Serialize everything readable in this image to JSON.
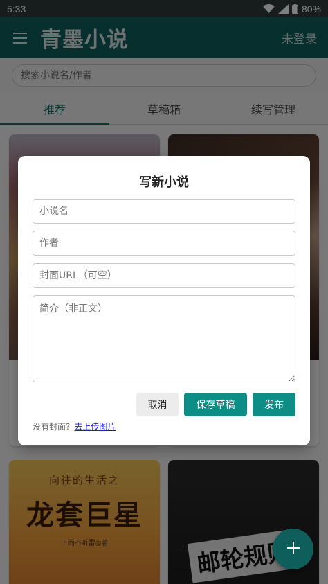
{
  "status_bar": {
    "time": "5:33",
    "battery": "80%"
  },
  "app_bar": {
    "title": "青墨小说",
    "login": "未登录"
  },
  "search": {
    "placeholder": "搜索小说名/作者"
  },
  "tabs": [
    {
      "label": "推荐",
      "active": true
    },
    {
      "label": "草稿箱",
      "active": false
    },
    {
      "label": "续写管理",
      "active": false
    }
  ],
  "covers": {
    "card3": {
      "subtitle": "向往的生活之",
      "title": "龙套巨星",
      "author": "下雨不听雷◎著"
    },
    "card4": {
      "title": "邮轮规则"
    }
  },
  "dialog": {
    "title": "写新小说",
    "fields": {
      "name_placeholder": "小说名",
      "author_placeholder": "作者",
      "cover_placeholder": "封面URL（可空）",
      "intro_placeholder": "简介（非正文）"
    },
    "buttons": {
      "cancel": "取消",
      "save": "保存草稿",
      "publish": "发布"
    },
    "hint_text": "没有封面?",
    "upload_link": "去上传图片"
  },
  "colors": {
    "primary": "#0e5f5c",
    "accent": "#0e8c86",
    "link": "#1a1aee"
  },
  "icons": {
    "menu": "menu-icon",
    "wifi": "wifi-icon",
    "signal": "signal-icon",
    "battery": "battery-icon",
    "fab": "plus-icon"
  }
}
